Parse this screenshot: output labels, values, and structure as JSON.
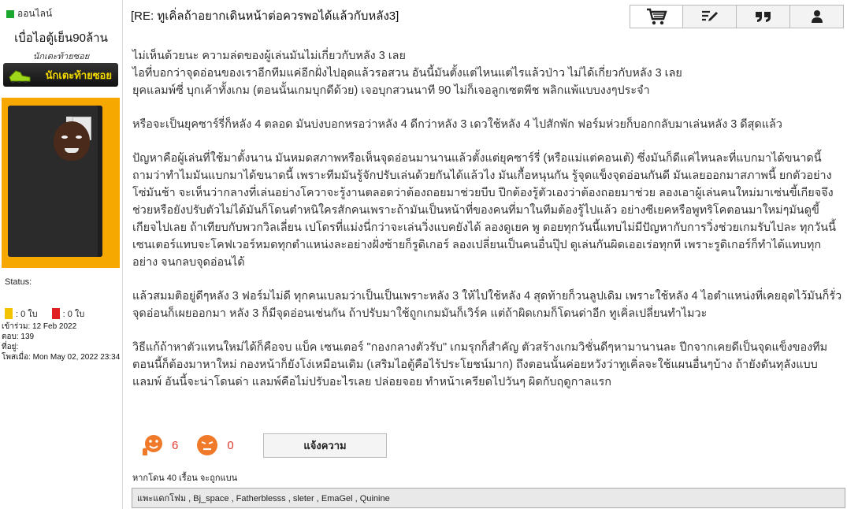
{
  "sidebar": {
    "online_status": "ออนไลน์",
    "username": "เบื่อไอตู้เย็น90ล้าน",
    "user_title": "นักเตะท้ายซอย",
    "rank_badge": "นักเตะท้ายซอย",
    "status_label": "Status:",
    "yellow_cards": ": 0 ใบ",
    "red_cards": ": 0 ใบ",
    "joined": "เข้าร่วม: 12 Feb 2022",
    "posts": "ตอบ: 139",
    "location": "ที่อยู่:",
    "posted_at": "โพสเมื่อ: Mon May 02, 2022 23:34"
  },
  "post": {
    "title": "[RE: ทูเคิ่ลถ้าอยากเดินหน้าต่อควรพอได้แล้วกับหลัง3]",
    "paragraphs": [
      "ไม่เห็นด้วยนะ ความล่ดของผู้เล่นมันไม่เกี่ยวกับหลัง 3 เลย\nไอที่บอกว่าจุดอ่อนของเราอีกทีมแค่อีกฝั่งไปอุดแล้วรอสวน อันนี้มันตั้งแต่ไหนแต่ไรแล้วป่าว ไม่ได้เกี่ยวกับหลัง 3 เลย\nยุคแลมพ์ซี่ บุกเค้าทั้งเกม (ตอนนั้นเกมบุกดีด้วย) เจอบุกสวนนาที 90 ไม่ก็เจอลูกเซตพีช พลิกแพ้แบบงงๆประจำ",
      "หรือจะเป็นยุคซาร์รี่ก็หลัง 4 ตลอด มันบ่งบอกหรอว่าหลัง 4 ดีกว่าหลัง 3 เดวใช้หลัง 4 ไปสักพัก ฟอร์มห่วยก็บอกกลับมาเล่นหลัง 3 ดีสุดแล้ว",
      "ปัญหาคือผู้เล่นที่ใช้มาตั้งนาน มันหมดสภาพหรือเห็นจุดอ่อนมานานแล้วตั้งแต่ยุคซาร์รี่ (หรือแม่แต่คอนเต้) ซึ่งมันก็ดีแค่ไหนละที่แบกมาได้ขนาดนี้ ถามว่าทำไมมันแบกมาได้ขนาดนี้ เพราะทีมมันรู้จักปรับเล่นด้วยกันได้แล้วไง มันเกื้อหนุนกัน รู้จุดแข็งจุดอ่อนกันดี มันเลยออกมาสภาพนี้ ยกตัวอย่าง โซ่มันช้า จะเห็นว่ากลางที่เล่นอย่างโควาจะรู้งานตลอดว่าต้องถอยมาช่วยบีบ ปีกต้องรู้ตัวเองว่าต้องถอยมาช่วย ลองเอาผู้เล่นคนใหม่มาเซ่นขี้เกียจจึงช่วยหรือยังปรับตัวไม่ได้มันก็โดนตำหนิใครสักคนเพราะถ้ามันเป็นหน้าที่ของคนที่มาในทีมต้องรู้ไปแล้ว อย่างซีเยคหรือพูทริโคตอนมาใหม่ๆมันดูขี้เกียจไปเลย ถ้าเทียบกับพวกวิลเลี่ยน เปโดรที่แม่งนี่กว่าจะเล่นวิ่งแบคยังได้ ลองดูเยค พู ดอยทุกวันนี้แทบไม่มีปัญหากับการวิ่งช่วยเกมรับไปละ ทุกวันนี้เซนเตอร์แทบจะโคฟเวอร์หมดทุกตำแหน่งละอย่างฝั่งซ้ายก็รูดิเกอร์ ลองเปลี่ยนเป็นคนอื่นปุ๊ป ดูเล่นกันผิดเออเร่อทุกที เพราะรูดิเกอร์ก็ทำได้แทบทุกอย่าง จนกลบจุดอ่อนได้",
      "แล้วสมมติอยู่ดีๆหลัง 3 ฟอร์มไม่ดี ทุกคนเบลมว่าเป็นเป็นเพราะหลัง 3 ให้ไปใช้หลัง 4 สุดท้ายก็วนลูปเดิม เพราะใช้หลัง 4 ไอตำแหน่งที่เคยอุดไว้มันก็รั่ว จุดอ่อนก็เผยออกมา หลัง 3 ก็มีจุดอ่อนเช่นกัน ถ้าปรับมาใช้ถูกเกมมันก็เวิร์ค แต่ถ้าผิดเกมก็โดนด่าอีก ทูเคิ่ลเปลี่ยนทำไมวะ",
      "วิธีแก้ถ้าหาตัวแทนใหม่ได้ก็คือจบ แบ็ค เซนเตอร์ \"กองกลางตัวรับ\" เกมรุกก็สำคัญ ตัวสร้างเกมวิชั่นดีๆหามานานละ ปีกจากเคยดีเป็นจุดแข็งของทีมตอนนี้ก็ต้องมาหาใหม่ กองหน้าก็ยังโง่เหมือนเดิม (เสริมไอตู้คือไร้ประโยชน์มาก) ถึงตอนนั้นค่อยหวังว่าทูเคิ่ลจะใช้แผนอื่นๆบ้าง ถ้ายังดันทุลังแบบแลมพ์ อันนี้จะน่าโดนด่า แลมพ์คือไม่ปรับอะไรเลย ปล่อยจอย ทำหน้าเครียดไปวันๆ ผิดกับฤดูกาลแรก"
    ]
  },
  "reactions": {
    "like_count": "6",
    "dislike_count": "0",
    "report_label": "แจ้งความ"
  },
  "flame_note": "หากโดน 40 เรื้อน จะถูกแบน",
  "likes_by": "แพะแดกโฟม , Bj_space , Fatherblesss , sleter , EmaGel , Quinine",
  "colors": {
    "online": "#1aa831",
    "reaction_count": "#e03b2e",
    "yellow_card": "#f2c300",
    "red_card": "#e02020",
    "avatar_bg": "#f7a800"
  }
}
